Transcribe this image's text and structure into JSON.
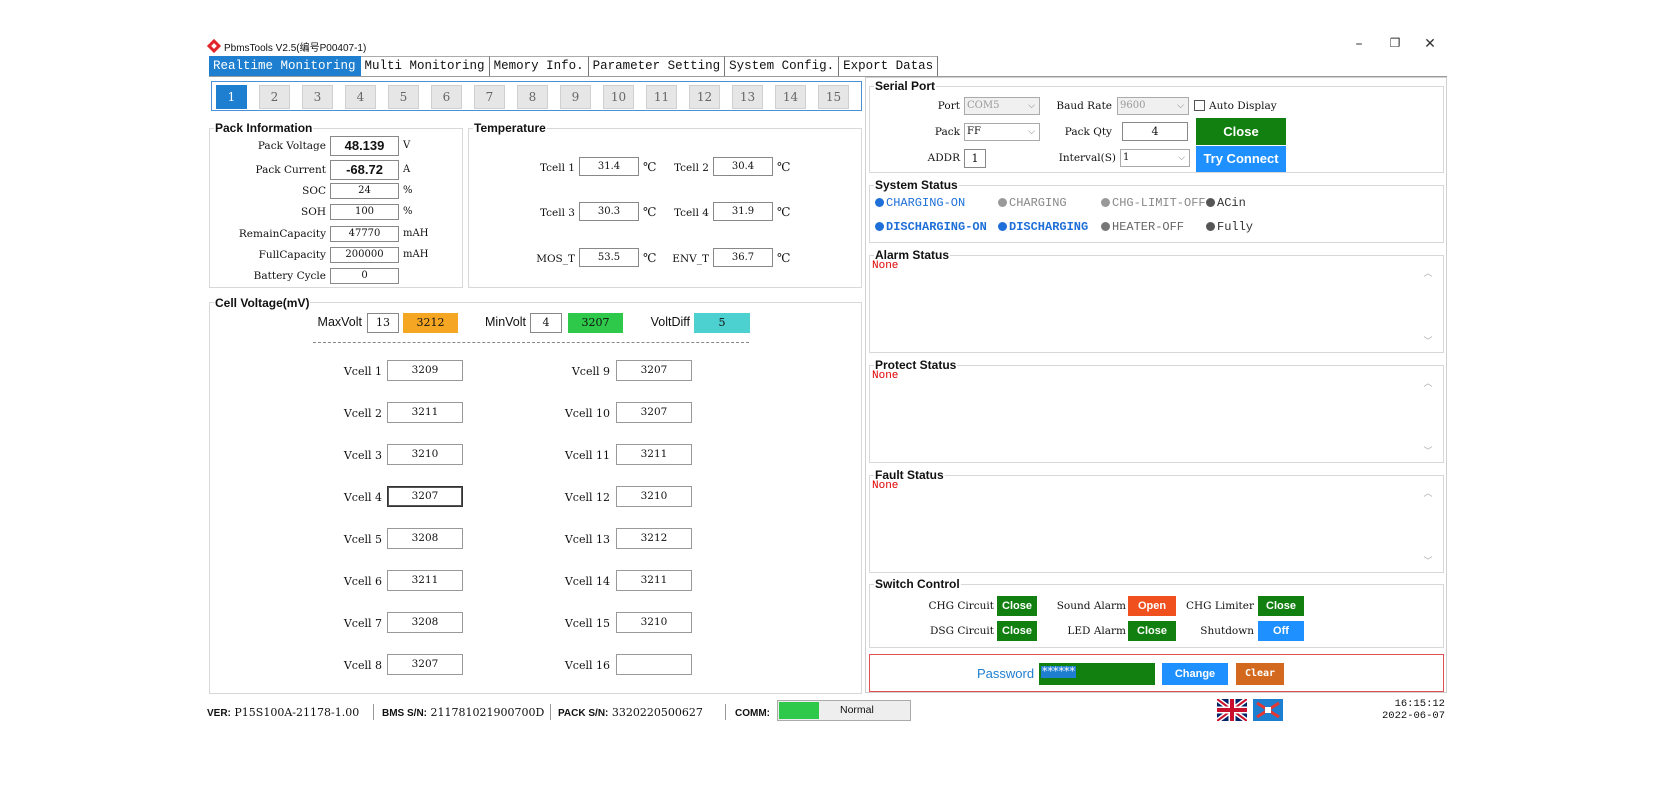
{
  "window": {
    "title": "PbmsTools V2.5(编号P00407-1)",
    "minimize": "–",
    "restore": "❐",
    "close": "✕"
  },
  "tabs": [
    "Realtime Monitoring",
    "Multi Monitoring",
    "Memory Info.",
    "Parameter Setting",
    "System Config.",
    "Export Datas"
  ],
  "packs": [
    "1",
    "2",
    "3",
    "4",
    "5",
    "6",
    "7",
    "8",
    "9",
    "10",
    "11",
    "12",
    "13",
    "14",
    "15"
  ],
  "pack_info": {
    "title": "Pack Information",
    "rows": [
      {
        "label": "Pack Voltage",
        "value": "48.139",
        "unit": "V"
      },
      {
        "label": "Pack Current",
        "value": "-68.72",
        "unit": "A"
      },
      {
        "label": "SOC",
        "value": "24",
        "unit": "%"
      },
      {
        "label": "SOH",
        "value": "100",
        "unit": "%"
      },
      {
        "label": "RemainCapacity",
        "value": "47770",
        "unit": "mAH"
      },
      {
        "label": "FullCapacity",
        "value": "200000",
        "unit": "mAH"
      },
      {
        "label": "Battery Cycle",
        "value": "0",
        "unit": ""
      }
    ]
  },
  "temperature": {
    "title": "Temperature",
    "unit": "℃",
    "items": [
      {
        "label": "Tcell 1",
        "value": "31.4"
      },
      {
        "label": "Tcell 2",
        "value": "30.4"
      },
      {
        "label": "Tcell 3",
        "value": "30.3"
      },
      {
        "label": "Tcell 4",
        "value": "31.9"
      },
      {
        "label": "MOS_T",
        "value": "53.5"
      },
      {
        "label": "ENV_T",
        "value": "36.7"
      }
    ]
  },
  "cell_voltage": {
    "title": "Cell Voltage(mV)",
    "max_label": "MaxVolt",
    "max_cell": "13",
    "max_value": "3212",
    "min_label": "MinVolt",
    "min_cell": "4",
    "min_value": "3207",
    "diff_label": "VoltDiff",
    "diff_value": "5",
    "cells": [
      {
        "label": "Vcell 1",
        "value": "3209"
      },
      {
        "label": "Vcell 2",
        "value": "3211"
      },
      {
        "label": "Vcell 3",
        "value": "3210"
      },
      {
        "label": "Vcell 4",
        "value": "3207"
      },
      {
        "label": "Vcell 5",
        "value": "3208"
      },
      {
        "label": "Vcell 6",
        "value": "3211"
      },
      {
        "label": "Vcell 7",
        "value": "3208"
      },
      {
        "label": "Vcell 8",
        "value": "3207"
      },
      {
        "label": "Vcell 9",
        "value": "3207"
      },
      {
        "label": "Vcell 10",
        "value": "3207"
      },
      {
        "label": "Vcell 11",
        "value": "3211"
      },
      {
        "label": "Vcell 12",
        "value": "3210"
      },
      {
        "label": "Vcell 13",
        "value": "3212"
      },
      {
        "label": "Vcell 14",
        "value": "3211"
      },
      {
        "label": "Vcell 15",
        "value": "3210"
      },
      {
        "label": "Vcell 16",
        "value": ""
      }
    ]
  },
  "serial_port": {
    "title": "Serial Port",
    "port_label": "Port",
    "port_value": "COM5",
    "baud_label": "Baud Rate",
    "baud_value": "9600",
    "auto_display_label": "Auto Display",
    "pack_label": "Pack",
    "pack_value": "FF",
    "pack_qty_label": "Pack Qty",
    "pack_qty_value": "4",
    "addr_label": "ADDR",
    "addr_value": "1",
    "interval_label": "Interval(S)",
    "interval_value": "1",
    "close_button": "Close",
    "try_connect_button": "Try Connect"
  },
  "system_status": {
    "title": "System Status",
    "items": [
      {
        "label": "CHARGING-ON",
        "color": "#1e6fd8",
        "active": true
      },
      {
        "label": "CHARGING",
        "color": "#999999",
        "active": false
      },
      {
        "label": "CHG-LIMIT-OFF",
        "color": "#999999",
        "active": false
      },
      {
        "label": "ACin",
        "color": "#555555",
        "active": false
      },
      {
        "label": "DISCHARGING-ON",
        "color": "#1e6fd8",
        "active": true
      },
      {
        "label": "DISCHARGING",
        "color": "#1e6fd8",
        "active": true
      },
      {
        "label": "HEATER-OFF",
        "color": "#777777",
        "active": false
      },
      {
        "label": "Fully",
        "color": "#555555",
        "active": false
      }
    ]
  },
  "alarm_status": {
    "title": "Alarm Status",
    "value": "None"
  },
  "protect_status": {
    "title": "Protect Status",
    "value": "None"
  },
  "fault_status": {
    "title": "Fault Status",
    "value": "None"
  },
  "switch_control": {
    "title": "Switch Control",
    "items": [
      {
        "label": "CHG Circuit",
        "state": "Close",
        "color": "#118011"
      },
      {
        "label": "Sound Alarm",
        "state": "Open",
        "color": "#f0501e"
      },
      {
        "label": "CHG Limiter",
        "state": "Close",
        "color": "#118011"
      },
      {
        "label": "DSG Circuit",
        "state": "Close",
        "color": "#118011"
      },
      {
        "label": "LED Alarm",
        "state": "Close",
        "color": "#118011"
      },
      {
        "label": "Shutdown",
        "state": "Off",
        "color": "#1e90ff"
      }
    ]
  },
  "password": {
    "label": "Password",
    "value": "******",
    "change_button": "Change",
    "clear_button": "Clear"
  },
  "status_bar": {
    "ver_label": "VER:",
    "ver_value": "P15S100A-21178-1.00",
    "bms_label": "BMS S/N:",
    "bms_value": "211781021900700D",
    "pack_label": "PACK S/N:",
    "pack_value": "3320220500627",
    "comm_label": "COMM:",
    "comm_value": "Normal",
    "time": "16:15:12",
    "date": "2022-06-07"
  },
  "colors": {
    "accent": "#1e7fd0",
    "green": "#118011",
    "orange": "#f5a623",
    "cyan": "#4dd0d0",
    "red_border": "#e05050"
  }
}
